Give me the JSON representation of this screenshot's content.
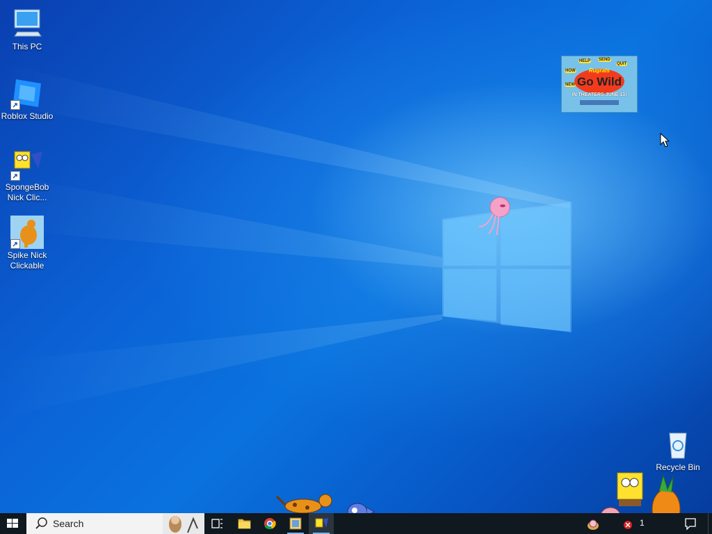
{
  "desktop": {
    "icons": [
      {
        "label": "This PC",
        "icon": "computer-icon"
      },
      {
        "label": "Roblox Studio",
        "icon": "roblox-studio-icon"
      },
      {
        "label": "SpongeBob Nick Clic...",
        "icon": "spongebob-icon"
      },
      {
        "label": "Spike Nick Clickable",
        "icon": "spike-dog-icon"
      },
      {
        "label": "Recycle Bin",
        "icon": "recycle-bin-icon"
      }
    ],
    "poster": {
      "top_words": [
        "HELP",
        "SEND",
        "QUIT",
        "HOW",
        "NEW"
      ],
      "brand": "Rugrats",
      "headline": "Go Wild",
      "subline": "IN THEATERS JUNE 13!"
    }
  },
  "taskbar": {
    "search_placeholder": "Search",
    "clock_fragment": "1",
    "pinned": [
      {
        "name": "task-view",
        "icon": "task-view-icon"
      },
      {
        "name": "file-explorer",
        "icon": "folder-icon"
      },
      {
        "name": "chrome",
        "icon": "chrome-icon"
      },
      {
        "name": "app-yellow",
        "icon": "app-icon"
      },
      {
        "name": "spongebob-app",
        "icon": "spongebob-icon"
      }
    ]
  },
  "colors": {
    "taskbar": "#101820",
    "accent": "#76b9ed",
    "desktop": "#0a6fdc"
  }
}
